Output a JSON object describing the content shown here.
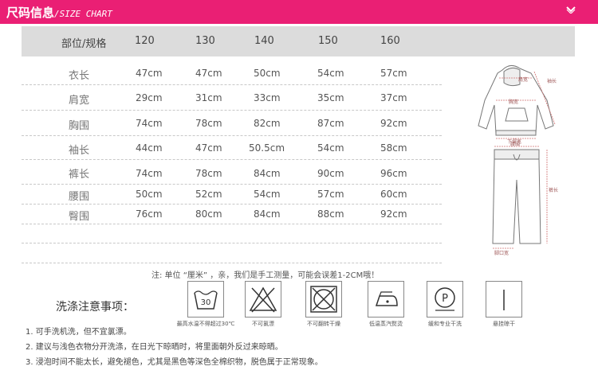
{
  "header": {
    "title": "尺码信息",
    "subtitle": "/SIZE CHART",
    "icon": "chevron-down-icon"
  },
  "table": {
    "columns": [
      "部位/规格",
      "120",
      "130",
      "140",
      "150",
      "160"
    ],
    "rows": [
      {
        "label": "衣长",
        "values": [
          "47cm",
          "47cm",
          "50cm",
          "54cm",
          "57cm"
        ]
      },
      {
        "label": "肩宽",
        "values": [
          "29cm",
          "31cm",
          "33cm",
          "35cm",
          "37cm"
        ]
      },
      {
        "label": "胸围",
        "values": [
          "74cm",
          "78cm",
          "82cm",
          "87cm",
          "92cm"
        ]
      },
      {
        "label": "袖长",
        "values": [
          "44cm",
          "47cm",
          "50.5cm",
          "54cm",
          "58cm"
        ]
      },
      {
        "label": "裤长",
        "values": [
          "74cm",
          "78cm",
          "84cm",
          "90cm",
          "96cm"
        ]
      },
      {
        "label": "腰围",
        "values": [
          "50cm",
          "52cm",
          "54cm",
          "57cm",
          "60cm"
        ]
      },
      {
        "label": "臀围",
        "values": [
          "76cm",
          "80cm",
          "84cm",
          "88cm",
          "92cm"
        ]
      }
    ]
  },
  "diagram": {
    "top_labels": {
      "shoulder": "肩宽",
      "sleeve": "袖长",
      "chest": "胸宽",
      "hem": "下摆宽"
    },
    "pants_labels": {
      "waist": "腰围",
      "length": "裤长",
      "leg_opening": "脚口宽"
    }
  },
  "note": "注: 单位 “厘米” ，亲，我们是手工测量，可能会误差1-2CM哦！",
  "washing": {
    "title": "洗涤注意事项：",
    "symbols": [
      {
        "icon": "wash-30-icon",
        "label": "最高水温不得超过30℃",
        "mark": "30"
      },
      {
        "icon": "no-bleach-icon",
        "label": "不可氯漂"
      },
      {
        "icon": "no-tumble-dry-icon",
        "label": "不可翻转干燥"
      },
      {
        "icon": "low-iron-icon",
        "label": "低温蒸汽熨烫"
      },
      {
        "icon": "dry-clean-p-icon",
        "label": "缓和专业干洗",
        "mark": "P"
      },
      {
        "icon": "hang-dry-icon",
        "label": "悬挂晾干"
      }
    ],
    "instructions": [
      "1. 可手洗机洗，但不宜氯漂。",
      "2. 建议与浅色衣物分开洗涤，在日光下晾晒时，将里面朝外反过来晾晒。",
      "3. 浸泡时间不能太长，避免褪色，尤其是黑色等深色全棉织物，脱色属于正常现象。"
    ]
  }
}
